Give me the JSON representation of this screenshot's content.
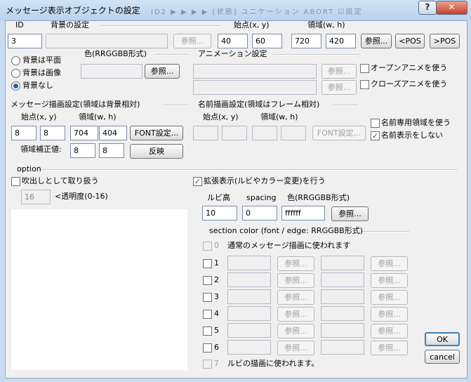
{
  "window": {
    "title": "メッセージ表示オブジェクトの設定",
    "help": "?",
    "close": "✕",
    "obscured_text": "ID2 ▶ ▶ ▶ ▶ [状態] ユニケーション ABORT ☑設定"
  },
  "id_group": {
    "label": "ID",
    "value": "3"
  },
  "bg": {
    "label": "背景の設定",
    "file_value": "",
    "browse": "参照...",
    "pos_label": "始点(x, y)",
    "x": "40",
    "y": "60",
    "size_label": "領域(w, h)",
    "w": "720",
    "h": "420",
    "browse2": "参照...",
    "pos_left": "<POS",
    "pos_right": ">POS",
    "radio_flat": "背景は平面",
    "radio_image": "背景は画像",
    "radio_none": "背景なし",
    "color_label": "色(RRGGBB形式)",
    "color_value": "",
    "color_browse": "参照..."
  },
  "anim": {
    "label": "アニメーション設定",
    "open_value": "",
    "open_browse": "参照...",
    "open_check": "オープンアニメを使う",
    "close_value": "",
    "close_browse": "参照...",
    "close_check": "クローズアニメを使う"
  },
  "msg": {
    "label": "メッセージ描画設定(領域は背景相対)",
    "pos_label": "始点(x, y)",
    "size_label": "領域(w, h)",
    "x": "8",
    "y": "8",
    "w": "704",
    "h": "404",
    "font_button": "FONT設定...",
    "correction_label": "領域補正値:",
    "cx": "8",
    "cy": "8",
    "apply_button": "反映"
  },
  "name": {
    "label": "名前描画設定(領域はフレーム相対)",
    "pos_label": "始点(x, y)",
    "size_label": "領域(w, h)",
    "x": "",
    "y": "",
    "w": "",
    "h": "",
    "font_button": "FONT設定...",
    "dedicated_area": "名前専用領域を使う",
    "hide_name": "名前表示をしない"
  },
  "option": {
    "label": "option",
    "balloon": "吹出しとして取り扱う",
    "alpha_value": "16",
    "alpha_label": "<透明度(0-16)"
  },
  "ext": {
    "check": "拡張表示(ルビやカラー変更)を行う",
    "ruby_label": "ルビ高",
    "ruby_value": "10",
    "spacing_label": "spacing",
    "spacing_value": "0",
    "color_label": "色(RRGGBB形式)",
    "color_value": "ffffff",
    "browse": "参照...",
    "section_label": "section color (font / edge: RRGGBB形式)",
    "row0_num": "0",
    "row0_text": "通常のメッセージ描画に使われます",
    "row7_num": "7",
    "row7_text": "ルビの描画に使われます。",
    "rows": [
      {
        "num": "1",
        "browse1": "参照...",
        "browse2": "参照..."
      },
      {
        "num": "2",
        "browse1": "参照...",
        "browse2": "参照..."
      },
      {
        "num": "3",
        "browse1": "参照...",
        "browse2": "参照..."
      },
      {
        "num": "4",
        "browse1": "参照...",
        "browse2": "参照..."
      },
      {
        "num": "5",
        "browse1": "参照...",
        "browse2": "参照..."
      },
      {
        "num": "6",
        "browse1": "参照...",
        "browse2": "参照..."
      }
    ]
  },
  "footer": {
    "ok": "OK",
    "cancel": "cancel"
  }
}
